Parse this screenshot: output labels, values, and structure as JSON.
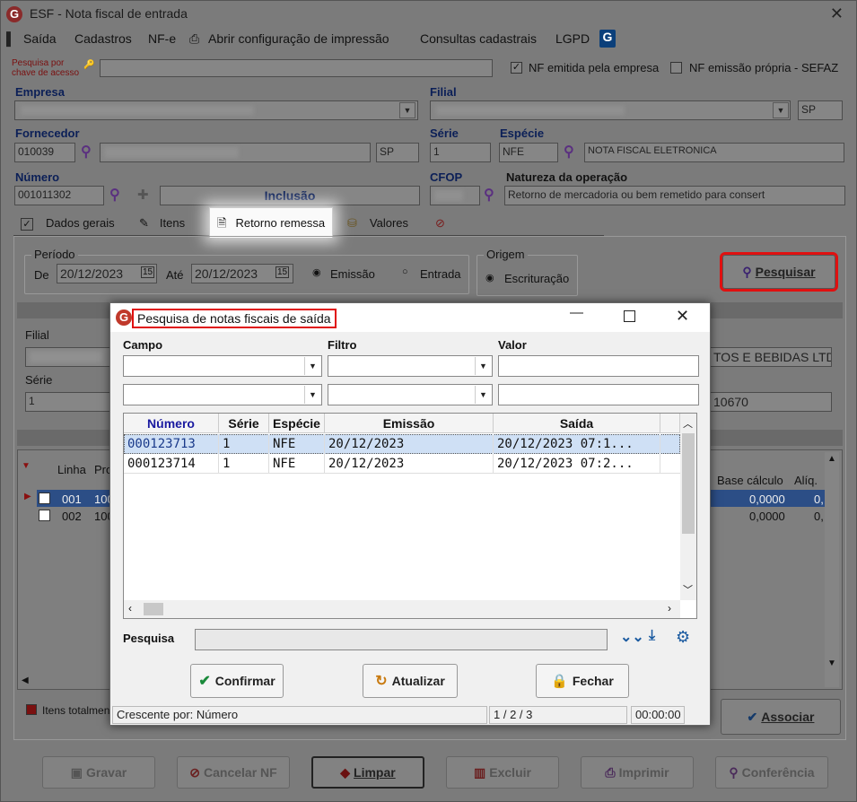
{
  "window": {
    "title": "ESF - Nota fiscal de entrada",
    "close": "✕"
  },
  "menu": [
    "Saída",
    "Cadastros",
    "NF-e",
    "Abrir configuração de impressão",
    "Consultas cadastrais",
    "LGPD"
  ],
  "header": {
    "search_key_label": "Pesquisa por chave de acesso",
    "nf_emitida_label": "NF emitida pela empresa",
    "nf_emitida_checked": true,
    "nf_propria_label": "NF emissão própria - SEFAZ",
    "nf_propria_checked": false,
    "empresa_label": "Empresa",
    "filial_label": "Filial",
    "filial_uf": "SP",
    "fornecedor_label": "Fornecedor",
    "fornecedor_code": "010039",
    "fornecedor_uf": "SP",
    "serie_label": "Série",
    "serie_value": "1",
    "especie_label": "Espécie",
    "especie_value": "NFE",
    "especie_desc": "NOTA FISCAL ELETRONICA",
    "numero_label": "Número",
    "numero_value": "001011302",
    "status_value": "Inclusão",
    "cfop_label": "CFOP",
    "natureza_label": "Natureza da operação",
    "natureza_value": "Retorno de mercadoria ou bem remetido para consert"
  },
  "tabs": [
    "Dados gerais",
    "Itens",
    "Retorno remessa",
    "Valores"
  ],
  "retorno": {
    "periodo_label": "Período",
    "de_label": "De",
    "de_value": "20/12/2023",
    "ate_label": "Até",
    "ate_value": "20/12/2023",
    "emissao_label": "Emissão",
    "entrada_label": "Entrada",
    "origem_label": "Origem",
    "escrituracao_label": "Escrituração",
    "pesquisar_label": "Pesquisar",
    "filial_label": "Filial",
    "serie_label": "Série",
    "serie_value": "1",
    "partial_name": "TOS E BEBIDAS LTD",
    "partial_num": "10670",
    "cols": [
      "Linha",
      "Pro",
      "Base cálculo",
      "Alíq."
    ],
    "rows": [
      {
        "linha": "001",
        "pro": "100",
        "base": "0,0000",
        "aliq": "0,"
      },
      {
        "linha": "002",
        "pro": "100",
        "base": "0,0000",
        "aliq": "0,"
      }
    ],
    "legend_label": "Itens totalmen",
    "associar_label": "Associar"
  },
  "footer_buttons": [
    "Gravar",
    "Cancelar NF",
    "Limpar",
    "Excluir",
    "Imprimir",
    "Conferência"
  ],
  "dialog": {
    "title": "Pesquisa de notas fiscais de saída",
    "campo_label": "Campo",
    "filtro_label": "Filtro",
    "valor_label": "Valor",
    "columns": [
      "Número",
      "Série",
      "Espécie",
      "Emissão",
      "Saída"
    ],
    "rows": [
      {
        "numero": "000123713",
        "serie": "1",
        "especie": "NFE",
        "emissao": "20/12/2023",
        "saida": "20/12/2023 07:1..."
      },
      {
        "numero": "000123714",
        "serie": "1",
        "especie": "NFE",
        "emissao": "20/12/2023",
        "saida": "20/12/2023 07:2..."
      }
    ],
    "pesquisa_label": "Pesquisa",
    "confirmar_label": "Confirmar",
    "atualizar_label": "Atualizar",
    "fechar_label": "Fechar",
    "status_sort": "Crescente por: Número",
    "status_pages": "1 / 2 / 3",
    "status_time": "00:00:00"
  }
}
